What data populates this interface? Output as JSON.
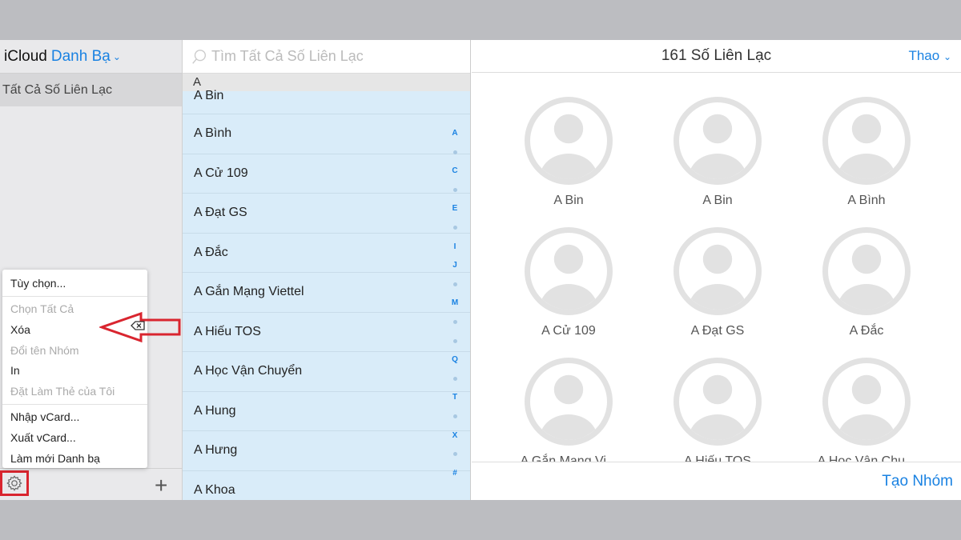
{
  "sidebar": {
    "app": "iCloud",
    "title": "Danh Bạ",
    "group": "Tất Cả Số Liên Lạc"
  },
  "menu": [
    {
      "label": "Tùy chọn...",
      "enabled": true
    },
    {
      "label": "Chọn Tất Cả",
      "enabled": false
    },
    {
      "label": "Xóa",
      "enabled": true
    },
    {
      "label": "Đổi tên Nhóm",
      "enabled": false
    },
    {
      "label": "In",
      "enabled": true
    },
    {
      "label": "Đặt Làm Thẻ của Tôi",
      "enabled": false
    },
    {
      "label": "Nhập vCard...",
      "enabled": true
    },
    {
      "label": "Xuất vCard...",
      "enabled": true
    },
    {
      "label": "Làm mới Danh bạ",
      "enabled": true
    }
  ],
  "list": {
    "search_placeholder": "Tìm Tất Cả Số Liên Lạc",
    "section": "A",
    "rows": [
      "A Bin",
      "A Bình",
      "A Cử 109",
      "A Đạt GS",
      "A Đắc",
      "A Gắn Mạng Viettel",
      "A Hiếu TOS",
      "A Học Vận Chuyển",
      "A Hung",
      "A Hưng",
      "A Khoa"
    ],
    "index": [
      "A",
      "•",
      "C",
      "•",
      "E",
      "•",
      "I",
      "J",
      "•",
      "M",
      "•",
      "•",
      "Q",
      "•",
      "T",
      "•",
      "X",
      "•",
      "#"
    ]
  },
  "detail": {
    "count": "161 Số Liên Lạc",
    "more": "Thao",
    "cards": [
      "A Bin",
      "A Bin",
      "A Bình",
      "A Cử 109",
      "A Đạt GS",
      "A Đắc",
      "A Gắn Mạng Vi...",
      "A Hiếu TOS",
      "A Học Vận Chu..."
    ],
    "create_group": "Tạo Nhóm"
  },
  "colors": {
    "accent": "#1a82e2",
    "highlight": "#d9252f",
    "list_bg": "#d9ecf9"
  }
}
